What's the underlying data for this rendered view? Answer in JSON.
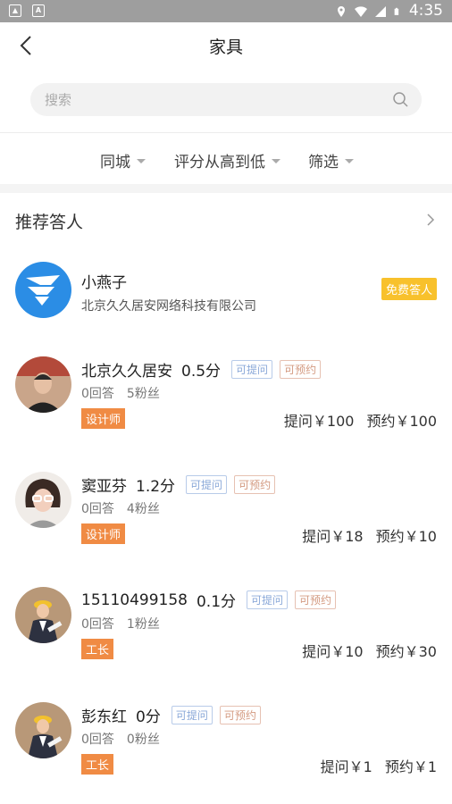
{
  "status_bar": {
    "time": "4:35"
  },
  "nav": {
    "title": "家具"
  },
  "search": {
    "placeholder": "搜索"
  },
  "filters": [
    {
      "label": "同城"
    },
    {
      "label": "评分从高到低"
    },
    {
      "label": "筛选"
    }
  ],
  "section": {
    "title": "推荐答人"
  },
  "featured": {
    "name": "小燕子",
    "company": "北京久久居安网络科技有限公司",
    "badge": "免费答人",
    "logo_color": "#2b8de5"
  },
  "experts": [
    {
      "name": "北京久久居安",
      "score": "0.5分",
      "tag_ask": "可提问",
      "tag_book": "可预约",
      "answers": "0回答",
      "fans": "5粉丝",
      "role": "设计师",
      "ask_price": "提问￥100",
      "book_price": "预约￥100"
    },
    {
      "name": "窦亚芬",
      "score": "1.2分",
      "tag_ask": "可提问",
      "tag_book": "可预约",
      "answers": "0回答",
      "fans": "4粉丝",
      "role": "设计师",
      "ask_price": "提问￥18",
      "book_price": "预约￥10"
    },
    {
      "name": "15110499158",
      "score": "0.1分",
      "tag_ask": "可提问",
      "tag_book": "可预约",
      "answers": "0回答",
      "fans": "1粉丝",
      "role": "工长",
      "ask_price": "提问￥10",
      "book_price": "预约￥30"
    },
    {
      "name": "彭东红",
      "score": "0分",
      "tag_ask": "可提问",
      "tag_book": "可预约",
      "answers": "0回答",
      "fans": "0粉丝",
      "role": "工长",
      "ask_price": "提问￥1",
      "book_price": "预约￥1"
    }
  ],
  "colors": {
    "role_badge": "#f08b44",
    "free_badge": "#f8c12c",
    "tag_ask": "#8aa8d8",
    "tag_book": "#d49b82"
  }
}
